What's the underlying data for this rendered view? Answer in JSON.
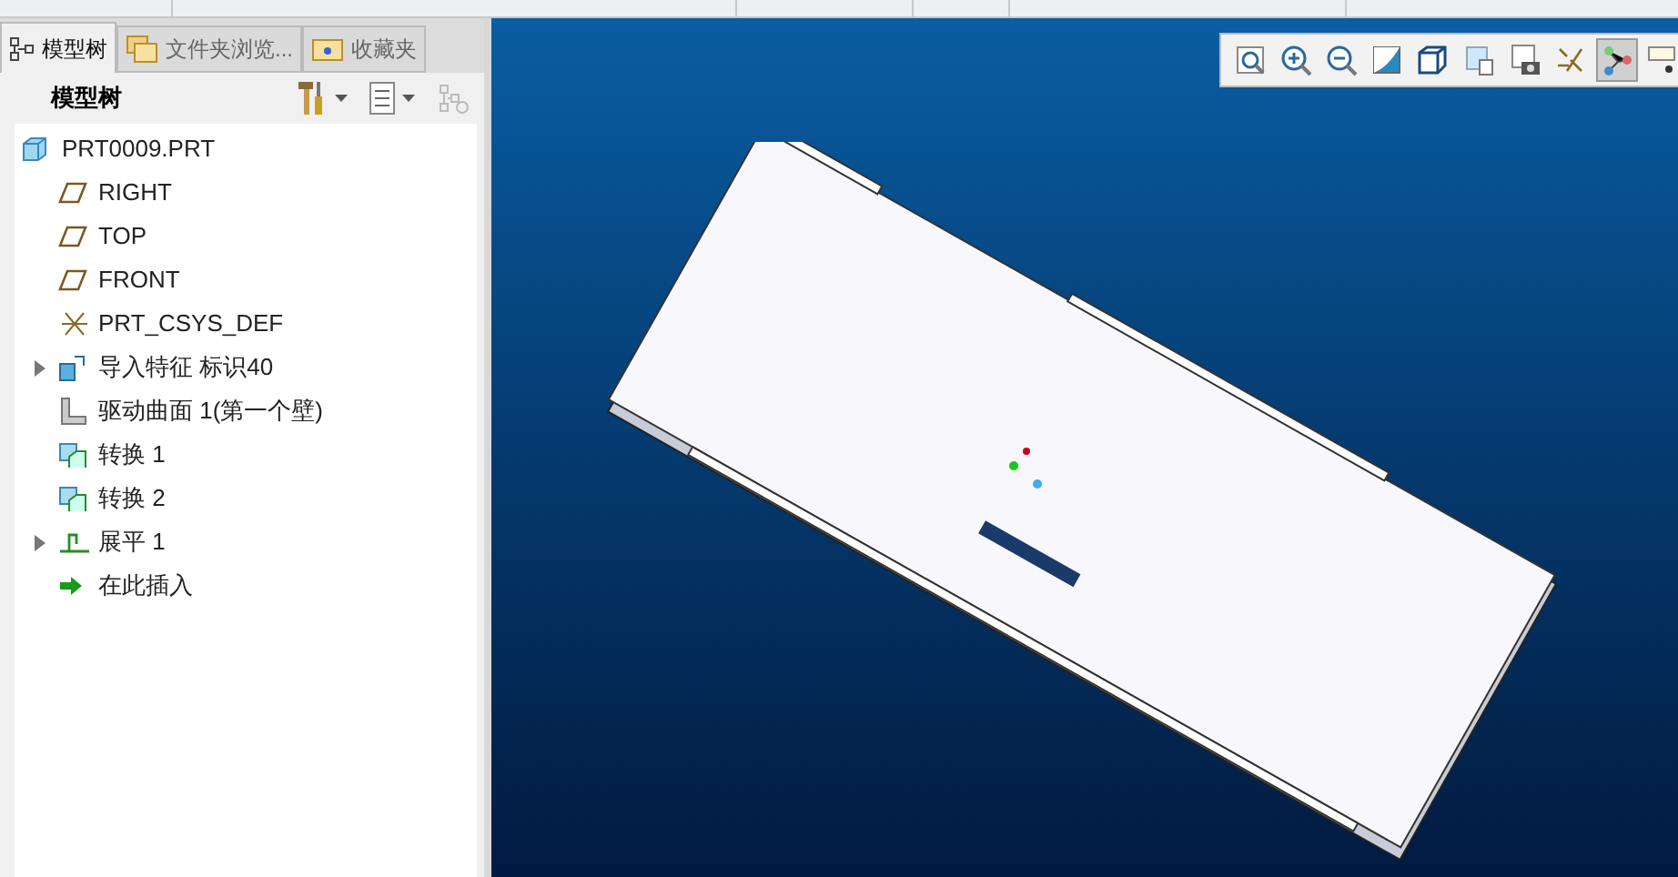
{
  "tabs": [
    {
      "label": "模型树",
      "kind": "tree",
      "selected": true
    },
    {
      "label": "文件夹浏览...",
      "kind": "folder",
      "selected": false
    },
    {
      "label": "收藏夹",
      "kind": "favorites",
      "selected": false
    }
  ],
  "panel_toolbar": {
    "title": "模型树"
  },
  "tree": [
    {
      "label": "PRT0009.PRT",
      "kind": "part",
      "children": [
        {
          "label": "RIGHT",
          "kind": "plane"
        },
        {
          "label": "TOP",
          "kind": "plane"
        },
        {
          "label": "FRONT",
          "kind": "plane"
        },
        {
          "label": "PRT_CSYS_DEF",
          "kind": "csys"
        },
        {
          "label": "导入特征 标识40",
          "kind": "import",
          "expanded": false
        },
        {
          "label": "驱动曲面 1(第一个壁)",
          "kind": "wall"
        },
        {
          "label": "转换 1",
          "kind": "convert"
        },
        {
          "label": "转换 2",
          "kind": "convert"
        },
        {
          "label": "展平 1",
          "kind": "flatten",
          "expanded": false
        },
        {
          "label": "在此插入",
          "kind": "insert"
        }
      ]
    }
  ],
  "view_toolbar": [
    {
      "kind": "refit",
      "on": false
    },
    {
      "kind": "zoom-in",
      "on": false
    },
    {
      "kind": "zoom-out",
      "on": false
    },
    {
      "kind": "repaint",
      "on": false
    },
    {
      "kind": "cube",
      "on": false
    },
    {
      "kind": "views",
      "on": false
    },
    {
      "kind": "camera",
      "on": false
    },
    {
      "kind": "datum",
      "on": false
    },
    {
      "kind": "connect",
      "on": true
    },
    {
      "kind": "tag",
      "on": false
    }
  ]
}
